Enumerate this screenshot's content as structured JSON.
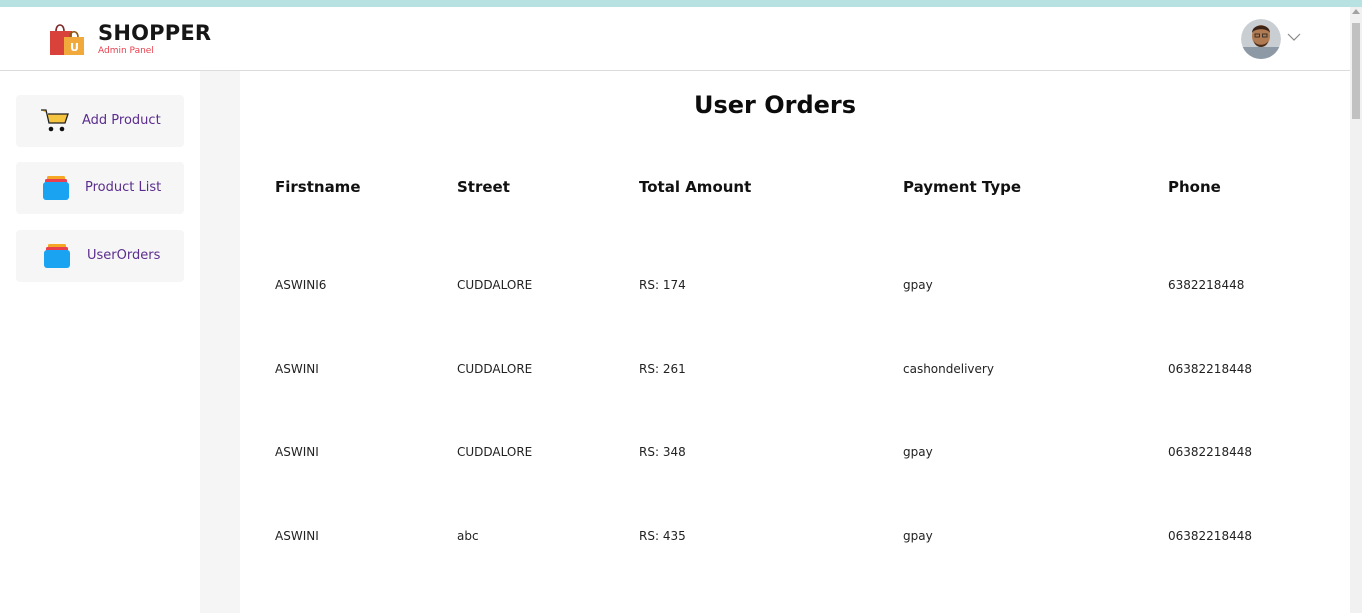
{
  "brand": {
    "title": "SHOPPER",
    "subtitle": "Admin Panel"
  },
  "navbar": {
    "avatar_icon": "user-avatar",
    "dropdown_icon": "chevron-down-icon"
  },
  "sidebar": {
    "items": [
      {
        "label": "Add Product",
        "icon": "cart-icon"
      },
      {
        "label": "Product List",
        "icon": "stack-icon"
      },
      {
        "label": "UserOrders",
        "icon": "stack-icon"
      }
    ]
  },
  "main": {
    "title": "User Orders",
    "columns": [
      "Firstname",
      "Street",
      "Total Amount",
      "Payment Type",
      "Phone"
    ],
    "rows": [
      [
        "ASWINI6",
        "CUDDALORE",
        "RS: 174",
        "gpay",
        "6382218448"
      ],
      [
        "ASWINI",
        "CUDDALORE",
        "RS: 261",
        "cashondelivery",
        "06382218448"
      ],
      [
        "ASWINI",
        "CUDDALORE",
        "RS: 348",
        "gpay",
        "06382218448"
      ],
      [
        "ASWINI",
        "abc",
        "RS: 435",
        "gpay",
        "06382218448"
      ]
    ]
  },
  "colors": {
    "accent": "#5b2d8e",
    "brand_sub": "#e8404f",
    "top_strip": "#b7e2e1"
  }
}
